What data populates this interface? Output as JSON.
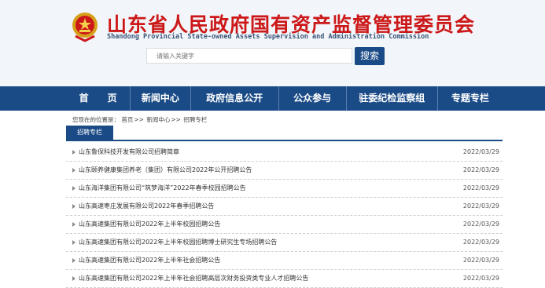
{
  "header": {
    "title": "山东省人民政府国有资产监督管理委员会",
    "subtitle": "Shandong Provincial State-owned Assets Supervision and Administration Commission",
    "emblem_icon": "national-emblem-icon",
    "search_placeholder": "请输入关键字",
    "search_button": "搜索"
  },
  "nav": {
    "items": [
      {
        "label": "首　　页"
      },
      {
        "label": "新闻中心"
      },
      {
        "label": "政府信息公开"
      },
      {
        "label": "公众参与"
      },
      {
        "label": "驻委纪检监察组"
      },
      {
        "label": "专题专栏"
      }
    ]
  },
  "breadcrumb": {
    "prefix": "您现在的位置是：",
    "items": [
      "首页",
      "新闻中心",
      "招聘专栏"
    ],
    "separator": ">>"
  },
  "section": {
    "tab": "招聘专栏"
  },
  "list": [
    {
      "title": "山东鲁保科技开发有限公司招聘简章",
      "date": "2022/03/29"
    },
    {
      "title": "山东颐养健康集团养老（集团）有限公司2022年公开招聘公告",
      "date": "2022/03/29"
    },
    {
      "title": "山东海洋集团有限公司“筑梦海洋”2022年春季校园招聘公告",
      "date": "2022/03/29"
    },
    {
      "title": "山东高速枣庄发展有限公司2022年春季招聘公告",
      "date": "2022/03/29"
    },
    {
      "title": "山东高速集团有限公司2022年上半年校园招聘公告",
      "date": "2022/03/29"
    },
    {
      "title": "山东高速集团有限公司2022年上半年校园招聘博士研究生专场招聘公告",
      "date": "2022/03/29"
    },
    {
      "title": "山东高速集团有限公司2022年上半年社会招聘公告",
      "date": "2022/03/29"
    },
    {
      "title": "山东高速集团有限公司2022年上半年社会招聘高层次财务投资类专业人才招聘公告",
      "date": "2022/03/29"
    }
  ],
  "colors": {
    "brand_red": "#cc1818",
    "nav_blue": "#1b4b86"
  }
}
